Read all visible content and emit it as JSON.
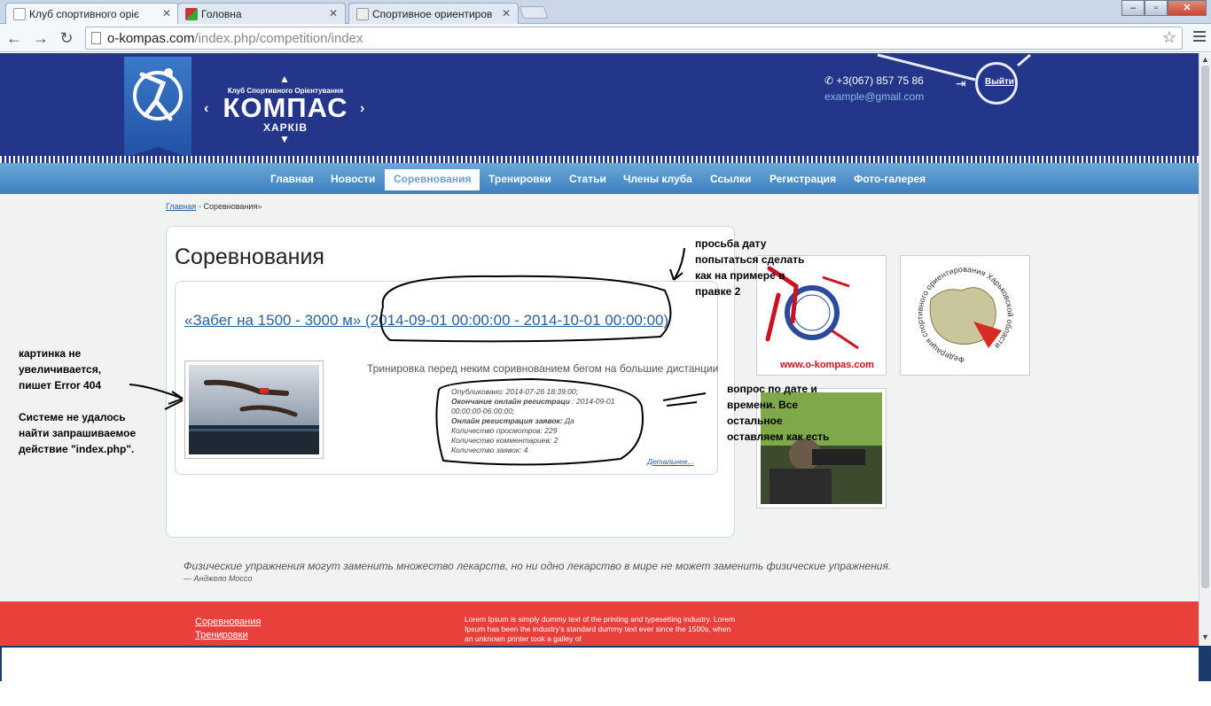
{
  "browser": {
    "tabs": [
      {
        "title": "Клуб спортивного оріє",
        "active": true
      },
      {
        "title": "Головна",
        "active": false
      },
      {
        "title": "Спортивное ориентиров",
        "active": false
      }
    ],
    "url_host": "o-kompas.com",
    "url_path": "/index.php/competition/index"
  },
  "header": {
    "logo_small": "Клуб Спортивного Орієнтування",
    "logo_big": "КОМПАС",
    "logo_city": "ХАРКІВ",
    "phone": "+3(067) 857 75 86",
    "email": "example@gmail.com",
    "logout": "Выйти"
  },
  "nav": {
    "items": [
      "Главная",
      "Новости",
      "Соревнования",
      "Тренировки",
      "Статьи",
      "Члены клуба",
      "Ссылки",
      "Регистрация",
      "Фото-галерея"
    ],
    "active_index": 2
  },
  "breadcrumb": {
    "home": "Главная",
    "current": "Соревнования"
  },
  "page_title": "Соревнования",
  "event": {
    "title": "«Забег на 1500 - 3000 м» (2014-09-01 00:00:00 - 2014-10-01 00:00:00)",
    "description": "Тринировка перед неким соривнованием бегом на большие дистанции",
    "published": "Опубликовано: 2014-07-26 18:39:00;",
    "registration_end": "Окончание онлайн регистраци",
    "registration_end_value": ": 2014-09-01 00:00:00-06:00:00;",
    "online_registration": "Онлайн регистрация заявок:",
    "online_registration_value": "Да",
    "views": "Количество просмотров: 229",
    "comments": "Количество комментариев: 2",
    "applications": "Количество заявок: 4",
    "more": "Детальнее..."
  },
  "sidebar": {
    "kompas_site": "www.o-kompas.com",
    "federation": "Федерация спортивного ориентирования Харьковской области"
  },
  "quote": {
    "text": "Физические упражнения могут заменить множество лекарств, но ни одно лекарство в мире не может заменить физические упражнения.",
    "author": "— Анджело Моссо"
  },
  "footer": {
    "links": [
      "Соревнования",
      "Тренировки"
    ],
    "text": "Lorem Ipsum is simply dummy text of the printing and typesetting industry. Lorem Ipsum has been the industry's standard dummy text ever since the 1500s, when an unknown printer took a galley of"
  },
  "annotations": {
    "date_request": "просьба дату попытаться сделать как на примере в правке 2",
    "image_note": "картинка не увеличивается, пишет Error 404",
    "system_note": "Системе не удалось найти запрашиваемое действие \"index.php\".",
    "time_question": "вопрос по дате и времени. Все остальное оставляем как есть"
  },
  "colors": {
    "header_blue": "#23368a",
    "nav_blue": "#3b7fbf",
    "footer_red": "#e8413c",
    "link_blue": "#2a5f9e"
  }
}
